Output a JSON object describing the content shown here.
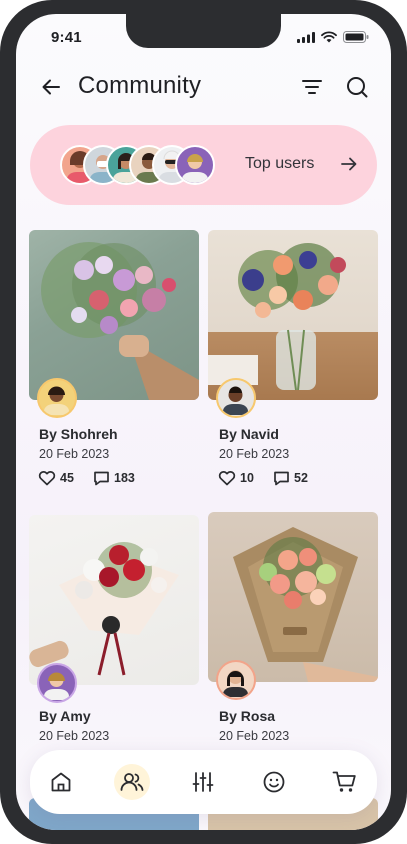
{
  "status": {
    "time": "9:41"
  },
  "header": {
    "title": "Community"
  },
  "top_users": {
    "label": "Top users"
  },
  "posts": [
    {
      "author": "By Shohreh",
      "date": "20 Feb 2023",
      "likes": "45",
      "comments": "183"
    },
    {
      "author": "By Navid",
      "date": "20 Feb 2023",
      "likes": "10",
      "comments": "52"
    },
    {
      "author": "By Amy",
      "date": "20 Feb 2023",
      "likes": "",
      "comments": ""
    },
    {
      "author": "By Rosa",
      "date": "20 Feb 2023",
      "likes": "",
      "comments": ""
    }
  ],
  "nav": {
    "items": [
      "home-icon",
      "community-icon",
      "sliders-icon",
      "smile-icon",
      "cart-icon"
    ],
    "active": "community-icon"
  },
  "colors": {
    "accent_pink": "#fdd3dd",
    "avatar_ring": "#f7c86d",
    "active_nav": "#fff4d9"
  }
}
